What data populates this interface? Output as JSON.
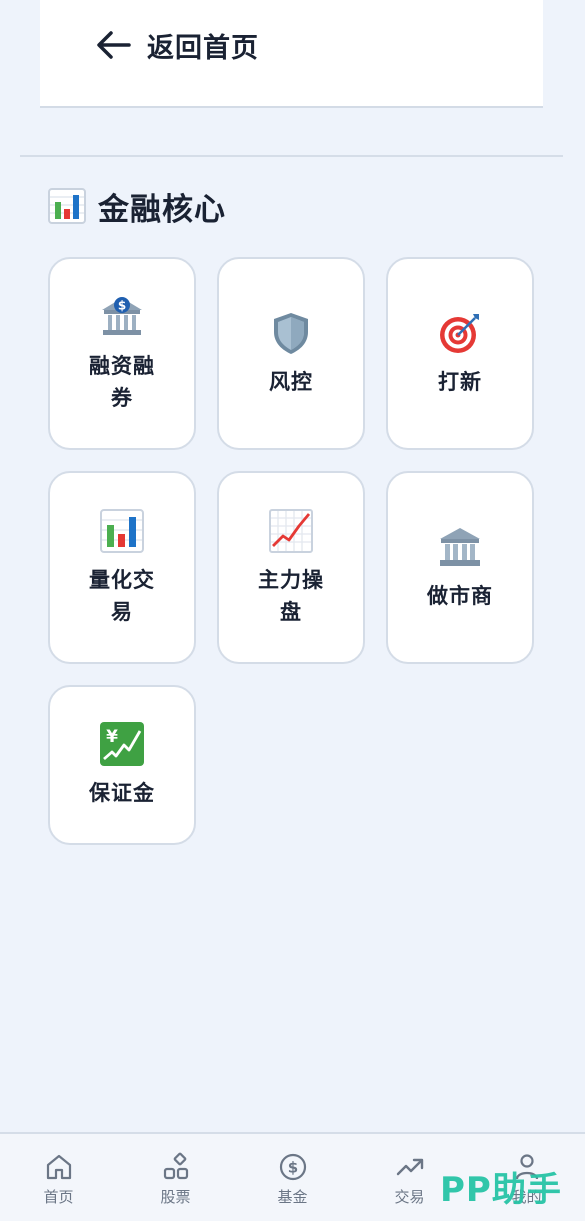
{
  "header": {
    "back_label": "返回首页"
  },
  "section": {
    "title": "金融核心"
  },
  "tiles": [
    {
      "label": "融资融券",
      "icon": "bank-dollar-icon"
    },
    {
      "label": "风控",
      "icon": "shield-icon"
    },
    {
      "label": "打新",
      "icon": "target-icon"
    },
    {
      "label": "量化交易",
      "icon": "bar-chart-icon"
    },
    {
      "label": "主力操盘",
      "icon": "trend-up-chart-icon"
    },
    {
      "label": "做市商",
      "icon": "classical-building-icon"
    },
    {
      "label": "保证金",
      "icon": "yen-chart-icon"
    }
  ],
  "nav": [
    {
      "label": "首页",
      "icon": "home-icon"
    },
    {
      "label": "股票",
      "icon": "blocks-icon"
    },
    {
      "label": "基金",
      "icon": "dollar-circle-icon"
    },
    {
      "label": "交易",
      "icon": "trend-arrow-icon"
    },
    {
      "label": "我的",
      "icon": "user-icon"
    }
  ],
  "watermark": "PP助手",
  "colors": {
    "background": "#eef3fb",
    "card": "#ffffff",
    "accent": "#27c4a6",
    "text": "#1a2233"
  }
}
